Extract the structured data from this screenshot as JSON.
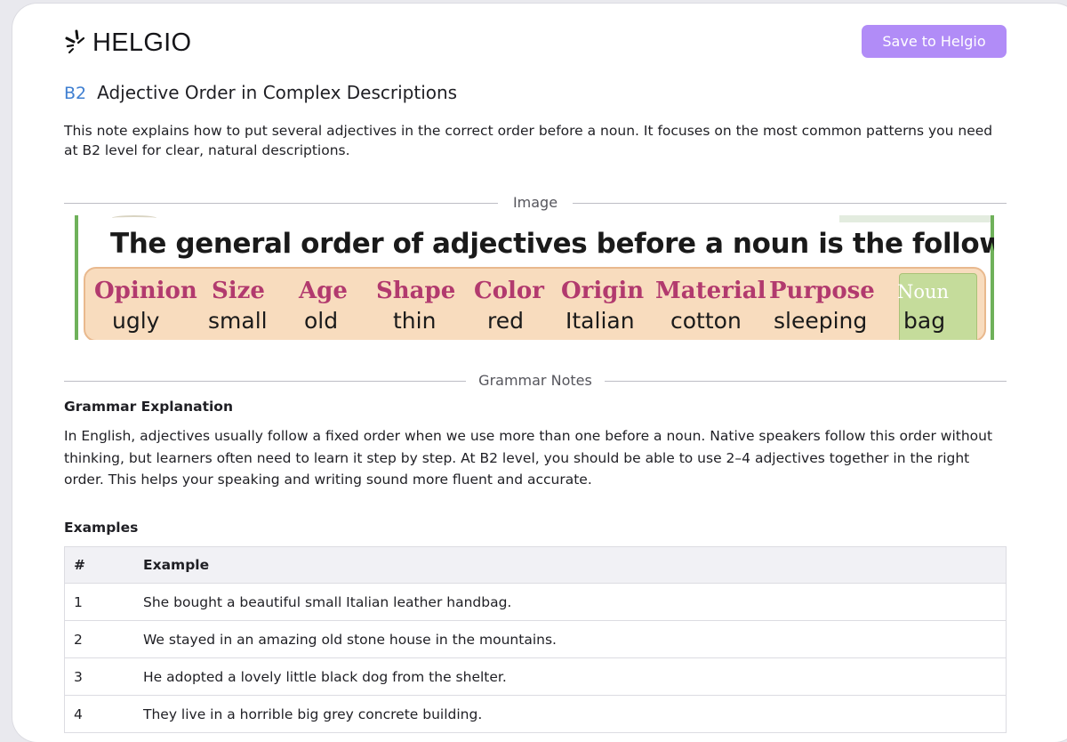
{
  "header": {
    "brand": "HELGIO",
    "save_label": "Save to Helgio"
  },
  "note": {
    "level": "B2",
    "title": "Adjective Order in Complex Descriptions",
    "intro": "This note explains how to put several adjectives in the correct order before a noun. It focuses on the most common patterns you need at B2 level for clear, natural descriptions."
  },
  "image_section": {
    "label": "Image",
    "heading": "The general order of adjectives before a noun is the following:",
    "categories": [
      "Opinion",
      "Size",
      "Age",
      "Shape",
      "Color",
      "Origin",
      "Material",
      "Purpose",
      "Noun"
    ],
    "examples": [
      "ugly",
      "small",
      "old",
      "thin",
      "red",
      "Italian",
      "cotton",
      "sleeping",
      "bag"
    ]
  },
  "grammar": {
    "label": "Grammar Notes",
    "heading": "Grammar Explanation",
    "text": "In English, adjectives usually follow a fixed order when we use more than one before a noun. Native speakers follow this order without thinking, but learners often need to learn it step by step. At B2 level, you should be able to use 2–4 adjectives together in the right order. This helps your speaking and writing sound more fluent and accurate."
  },
  "examples": {
    "heading": "Examples",
    "columns": [
      "#",
      "Example"
    ],
    "rows": [
      [
        "1",
        "She bought a beautiful small Italian leather handbag."
      ],
      [
        "2",
        "We stayed in an amazing old stone house in the mountains."
      ],
      [
        "3",
        "He adopted a lovely little black dog from the shelter."
      ],
      [
        "4",
        "They live in a horrible big grey concrete building."
      ]
    ]
  },
  "colors": {
    "accent": "#b18cf7",
    "level": "#3f7fd1",
    "category_text": "#b23a6e"
  },
  "icons": {
    "brand": "helgio-logo-icon"
  }
}
